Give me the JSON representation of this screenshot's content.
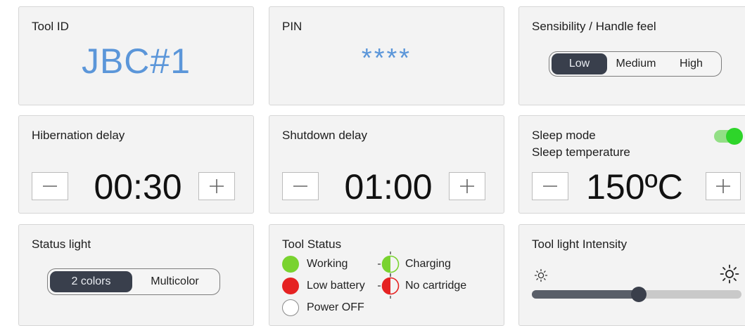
{
  "tool_id": {
    "title": "Tool ID",
    "value": "JBC#1"
  },
  "pin": {
    "title": "PIN",
    "value": "****"
  },
  "sensibility": {
    "title": "Sensibility / Handle feel",
    "options": [
      "Low",
      "Medium",
      "High"
    ],
    "selected": "Low"
  },
  "hibernation": {
    "title": "Hibernation delay",
    "value": "00:30"
  },
  "shutdown": {
    "title": "Shutdown delay",
    "value": "01:00"
  },
  "sleep": {
    "title": "Sleep mode",
    "subtitle": "Sleep temperature",
    "value": "150ºC",
    "toggle_on": true
  },
  "status_light": {
    "title": "Status light",
    "options": [
      "2 colors",
      "Multicolor"
    ],
    "selected": "2 colors"
  },
  "tool_status": {
    "title": "Tool Status",
    "legend": [
      {
        "label": "Working",
        "color": "#79d32f"
      },
      {
        "label": "Low battery",
        "color": "#e52222"
      },
      {
        "label": "Power OFF",
        "color": "#ffffff"
      },
      {
        "label": "Charging",
        "color": "#79d32f"
      },
      {
        "label": "No cartridge",
        "color": "#e52222"
      }
    ]
  },
  "tool_light": {
    "title": "Tool light Intensity",
    "level": 0.51
  },
  "icons": {
    "minus": "minus-icon",
    "plus": "plus-icon",
    "sun_small": "sun-small-icon",
    "sun_large": "sun-large-icon"
  },
  "colors": {
    "accent_blue": "#5b96d9",
    "segment_active": "#393f4c",
    "toggle_on": "#2ed52a",
    "slider_fill": "#595e68"
  }
}
